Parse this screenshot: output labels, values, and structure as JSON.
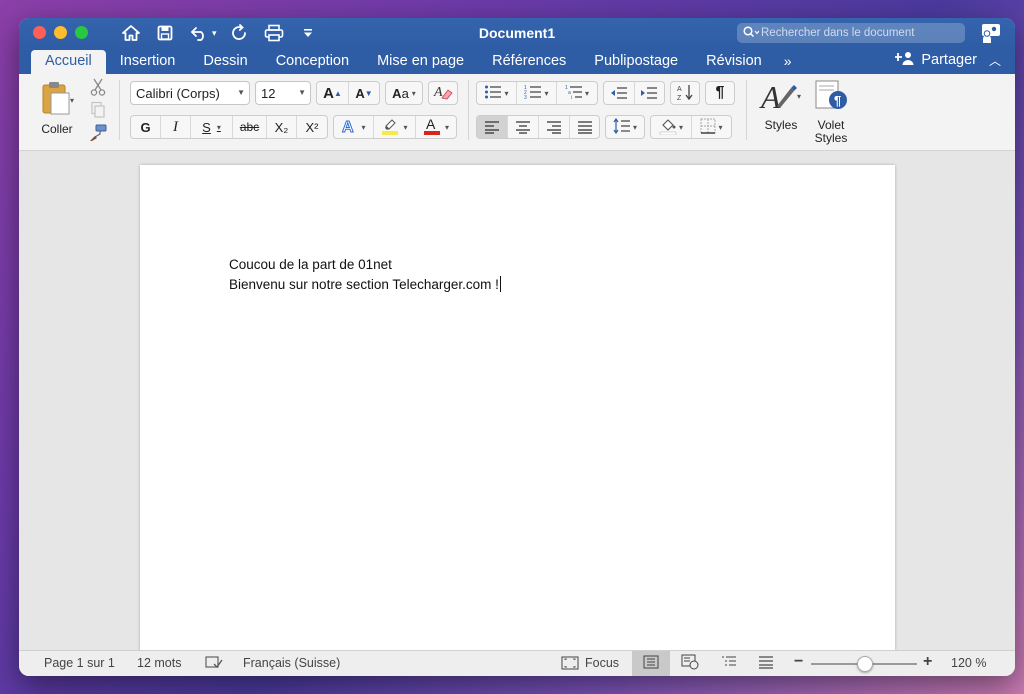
{
  "window": {
    "title": "Document1",
    "search_placeholder": "Rechercher dans le document"
  },
  "tabs": [
    {
      "label": "Accueil",
      "active": true
    },
    {
      "label": "Insertion"
    },
    {
      "label": "Dessin"
    },
    {
      "label": "Conception"
    },
    {
      "label": "Mise en page"
    },
    {
      "label": "Références"
    },
    {
      "label": "Publipostage"
    },
    {
      "label": "Révision"
    }
  ],
  "tabs_more": "»",
  "share_label": "Partager",
  "ribbon": {
    "paste_label": "Coller",
    "font_name": "Calibri (Corps)",
    "font_size": "12",
    "bold": "G",
    "italic": "I",
    "underline": "S",
    "strike": "abc",
    "subscript": "X₂",
    "superscript": "X²",
    "styles_label": "Styles",
    "styles_pane_line1": "Volet",
    "styles_pane_line2": "Styles"
  },
  "document": {
    "line1": "Coucou de la part de 01net",
    "line2": "Bienvenu sur notre section Telecharger.com !"
  },
  "status": {
    "page": "Page 1 sur 1",
    "words": "12 mots",
    "language": "Français (Suisse)",
    "focus": "Focus",
    "zoom": "120 %",
    "zoom_value": 120
  },
  "colors": {
    "brand_blue": "#2f5da5",
    "highlight_yellow": "#f7e94a",
    "font_color_red": "#d9261c"
  }
}
